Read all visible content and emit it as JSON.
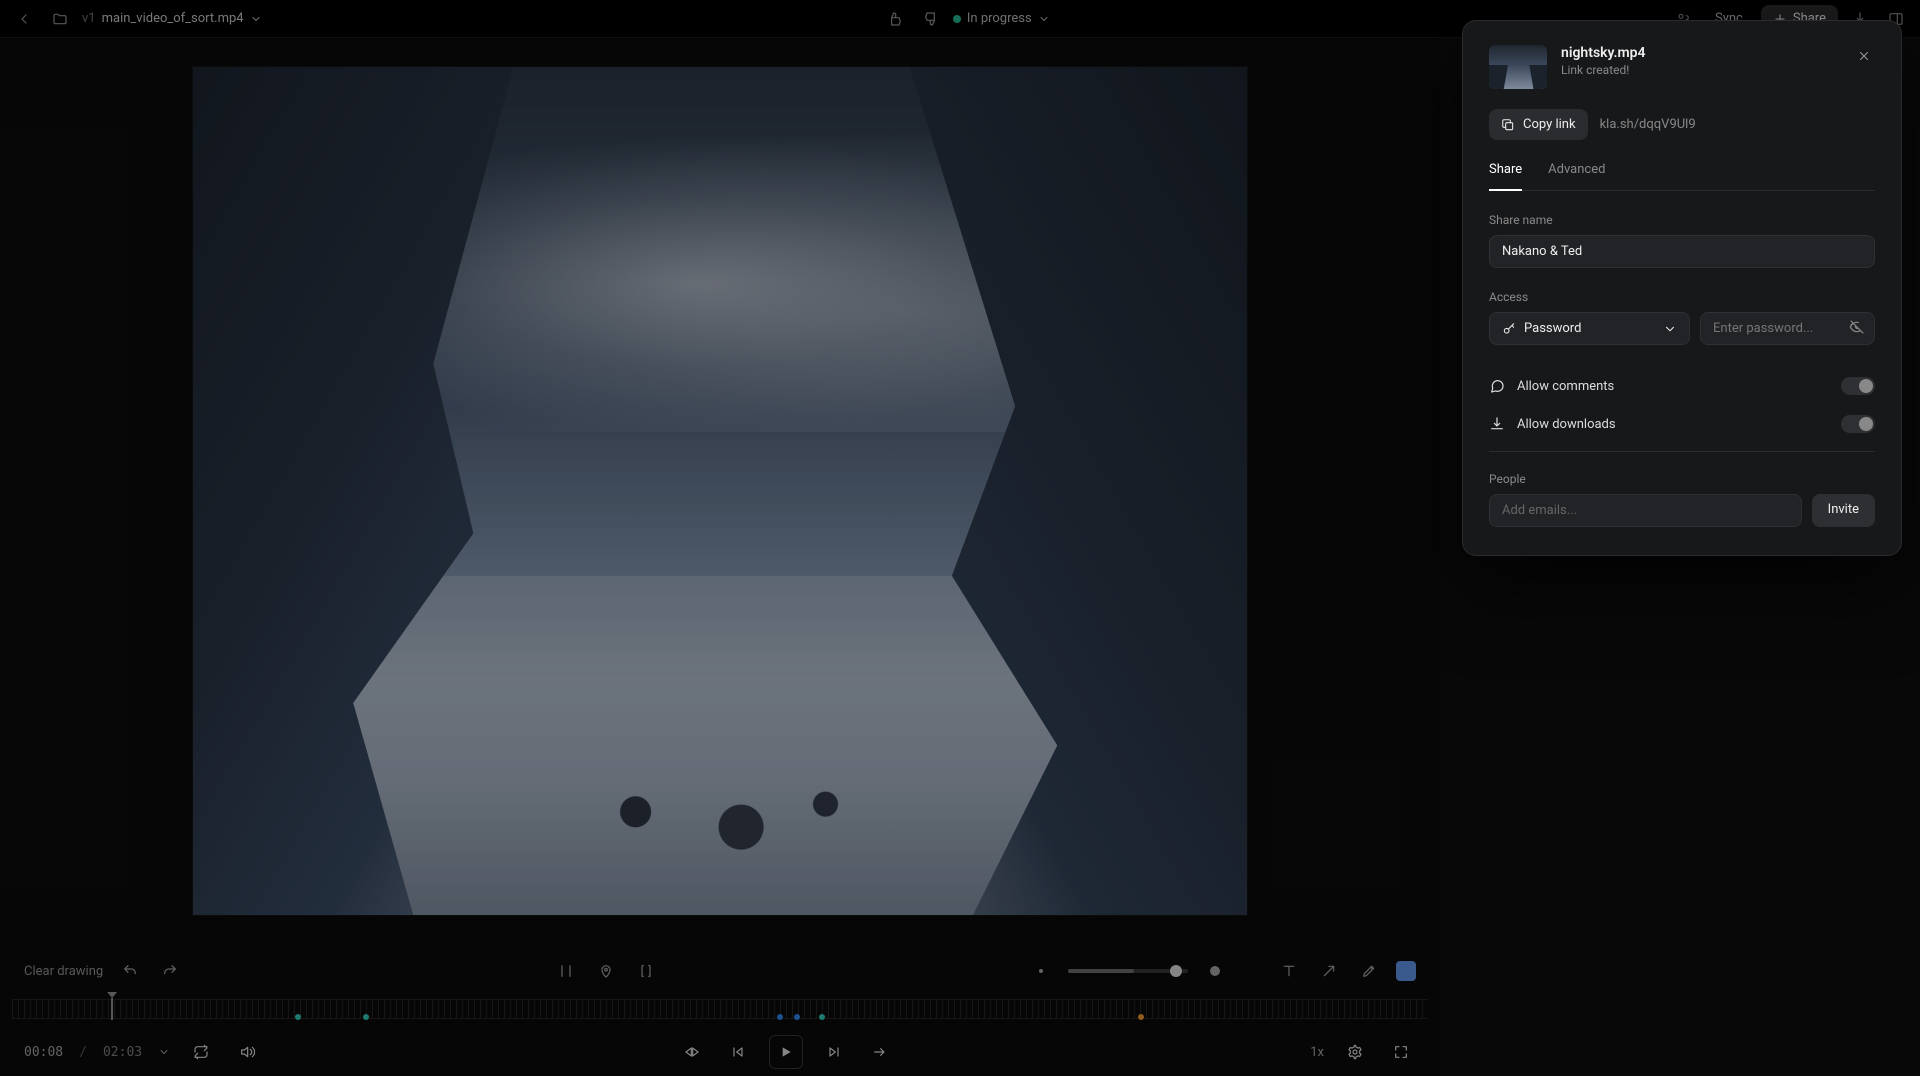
{
  "topbar": {
    "version": "v1",
    "filename": "main_video_of_sort.mp4",
    "status": "In progress",
    "sync": "Sync",
    "share": "Share"
  },
  "drawbar": {
    "clear": "Clear drawing"
  },
  "transport": {
    "current": "00:08",
    "separator": "/",
    "total": "02:03",
    "speed": "1x"
  },
  "timeline": {
    "markers": [
      {
        "pos": 20,
        "color": "m-teal"
      },
      {
        "pos": 24.8,
        "color": "m-teal"
      },
      {
        "pos": 54,
        "color": "m-blue"
      },
      {
        "pos": 55.2,
        "color": "m-blue"
      },
      {
        "pos": 57,
        "color": "m-teal"
      },
      {
        "pos": 79.5,
        "color": "m-orange"
      }
    ]
  },
  "share_panel": {
    "title": "nightsky.mp4",
    "subtitle": "Link created!",
    "copy_label": "Copy link",
    "link": "kla.sh/dqqV9Ul9",
    "tabs": {
      "share": "Share",
      "advanced": "Advanced"
    },
    "share_name_label": "Share name",
    "share_name_value": "Nakano & Ted",
    "access_label": "Access",
    "access_mode": "Password",
    "password_placeholder": "Enter password...",
    "allow_comments": "Allow comments",
    "allow_downloads": "Allow downloads",
    "people_label": "People",
    "people_placeholder": "Add emails...",
    "invite": "Invite"
  }
}
